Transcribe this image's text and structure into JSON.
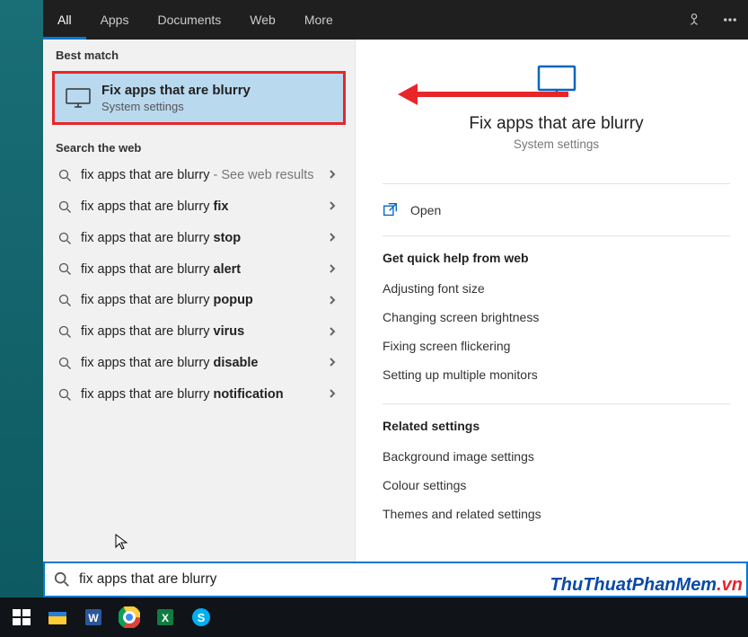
{
  "tabs": {
    "all": "All",
    "apps": "Apps",
    "documents": "Documents",
    "web": "Web",
    "more": "More"
  },
  "sections": {
    "best_match": "Best match",
    "search_web": "Search the web"
  },
  "best_match": {
    "title": "Fix apps that are blurry",
    "subtitle": "System settings"
  },
  "web_suggestions": [
    {
      "prefix": "fix apps that are blurry",
      "bold": "",
      "tail": " - See web results"
    },
    {
      "prefix": "fix apps that are blurry ",
      "bold": "fix",
      "tail": ""
    },
    {
      "prefix": "fix apps that are blurry ",
      "bold": "stop",
      "tail": ""
    },
    {
      "prefix": "fix apps that are blurry ",
      "bold": "alert",
      "tail": ""
    },
    {
      "prefix": "fix apps that are blurry ",
      "bold": "popup",
      "tail": ""
    },
    {
      "prefix": "fix apps that are blurry ",
      "bold": "virus",
      "tail": ""
    },
    {
      "prefix": "fix apps that are blurry ",
      "bold": "disable",
      "tail": ""
    },
    {
      "prefix": "fix apps that are blurry ",
      "bold": "notification",
      "tail": ""
    }
  ],
  "preview": {
    "title": "Fix apps that are blurry",
    "subtitle": "System settings",
    "open": "Open",
    "quick_help_header": "Get quick help from web",
    "quick_help": [
      "Adjusting font size",
      "Changing screen brightness",
      "Fixing screen flickering",
      "Setting up multiple monitors"
    ],
    "related_header": "Related settings",
    "related": [
      "Background image settings",
      "Colour settings",
      "Themes and related settings"
    ]
  },
  "search": {
    "value": "fix apps that are blurry"
  },
  "watermark": {
    "main": "ThuThuatPhanMem",
    "ext": ".vn"
  }
}
